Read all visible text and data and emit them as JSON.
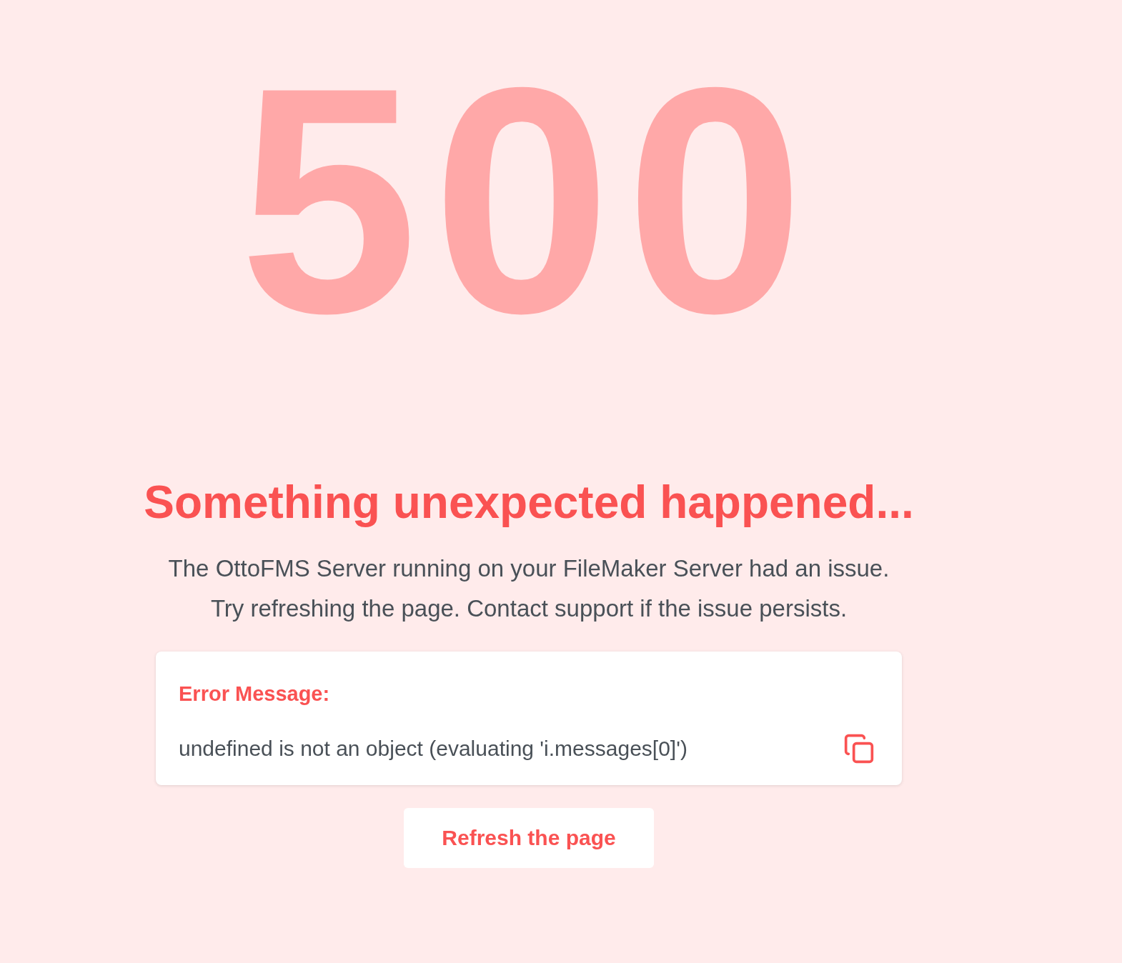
{
  "code": "500",
  "heading": "Something unexpected happened...",
  "description": "The OttoFMS Server running on your FileMaker Server had an issue. Try refreshing the page. Contact support if the issue persists.",
  "error_card": {
    "label": "Error Message:",
    "message": "undefined is not an object (evaluating 'i.messages[0]')"
  },
  "button": "Refresh the page"
}
